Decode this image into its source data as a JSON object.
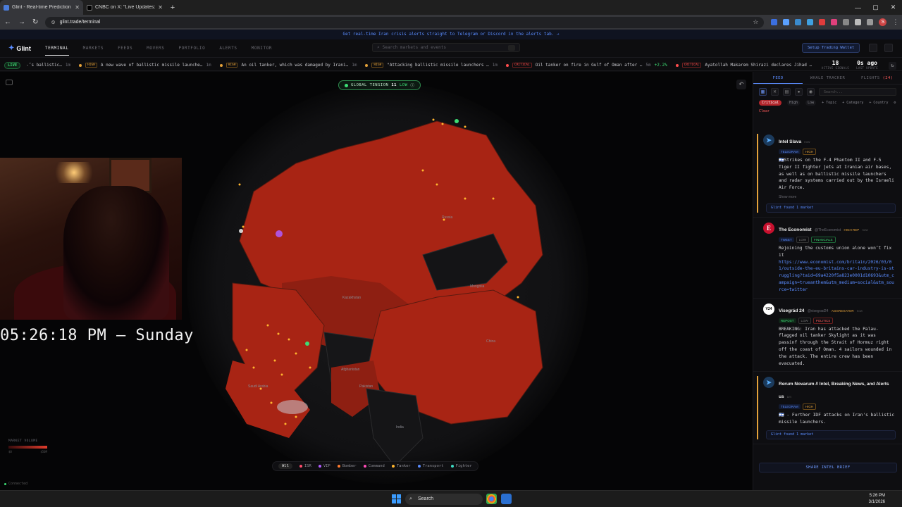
{
  "browser": {
    "tabs": [
      {
        "title": "Glint - Real-time Prediction Ma",
        "active": true
      },
      {
        "title": "CNBC on X: \"Live Updates: Isra",
        "active": false
      }
    ],
    "url": "glint.trade/terminal"
  },
  "banner": "Get real-time Iran crisis alerts straight to Telegram or Discord in the alerts tab. →",
  "nav": {
    "logo": "Glint",
    "items": [
      "TERMINAL",
      "MARKETS",
      "FEEDS",
      "MOVERS",
      "PORTFOLIO",
      "ALERTS",
      "MONITOR"
    ],
    "search_placeholder": "Search markets and events",
    "wallet_button": "Setup Trading Wallet"
  },
  "ticker": {
    "live_label": "LIVE",
    "items": [
      {
        "text": "-’s ballistic…",
        "time": "1m",
        "badge": "",
        "extra": ""
      },
      {
        "text": "A new wave of ballistic missile launche…",
        "time": "1m",
        "badge": "HIGH",
        "extra": ""
      },
      {
        "text": "An oil tanker, which was damaged by Irani…",
        "time": "1m",
        "badge": "HIGH",
        "extra": ""
      },
      {
        "text": "\"Attacking ballistic missile launchers …",
        "time": "1m",
        "badge": "HIGH",
        "extra": ""
      },
      {
        "text": "Oil tanker on fire in Gulf of Oman after …",
        "time": "5m",
        "badge": "CRITICAL",
        "extra": "+2.2%"
      },
      {
        "text": "Ayatollah Makarem Shirazi declares Jihad …",
        "time": "",
        "badge": "CRITICAL",
        "extra": ""
      }
    ],
    "active_signals": "18",
    "active_signals_label": "ACTIVE SIGNALS",
    "last_update": "0s ago",
    "last_update_label": "LAST UPDATE"
  },
  "map": {
    "tension_label": "GLOBAL TENSION",
    "tension_value": "11",
    "tension_level": "LOW",
    "clock": "05:26:18 PM – Sunday",
    "labels": [
      "Russia",
      "Kazakhstan",
      "Mongolia",
      "China",
      "Afghanistan",
      "Pakistan",
      "India",
      "Saudi Arabia",
      "Iran"
    ],
    "market_volume_label": "MARKET VOLUME",
    "volume_min": "$0",
    "volume_max": "$50M",
    "legend": [
      {
        "label": "All",
        "color": ""
      },
      {
        "label": "ISR",
        "color": "#ff4d6d"
      },
      {
        "label": "VIP",
        "color": "#b05cff"
      },
      {
        "label": "Bomber",
        "color": "#ff7a2e"
      },
      {
        "label": "Command",
        "color": "#ff4db8"
      },
      {
        "label": "Tanker",
        "color": "#ffb52e"
      },
      {
        "label": "Transport",
        "color": "#5a8cff"
      },
      {
        "label": "Fighter",
        "color": "#3ddcc4"
      }
    ],
    "status": "Connected"
  },
  "panel": {
    "tabs": [
      {
        "label": "FEED",
        "count": ""
      },
      {
        "label": "WHALE TRACKER",
        "count": ""
      },
      {
        "label": "FLIGHTS",
        "count": "(24)"
      }
    ],
    "search_placeholder": "Search...",
    "filters": {
      "critical": "Critical",
      "high": "High",
      "low": "Low",
      "topic": "+ Topic",
      "category": "+ Category",
      "country": "+ Country",
      "clear": "Clear"
    },
    "cards": [
      {
        "source": "Intel Slava",
        "handle": "",
        "role": "",
        "time": "now",
        "tags": [
          "TELEGRAM",
          "HIGH"
        ],
        "body": "🇮🇱Strikes on the F-4 Phantom II and F-5 Tiger II fighter jets at Iranian air bases, as well as on ballistic missile launchers and radar systems carried out by the Israeli Air Force.",
        "more": "Show more",
        "found": "Glint found 1 market"
      },
      {
        "source": "The Economist",
        "handle": "@TheEconomist",
        "role": "HIGH REP",
        "time": "now",
        "tags": [
          "TWEET",
          "LOW",
          "FINANCIALS"
        ],
        "body": "Rejoining the customs union alone won’t fix it",
        "link": "https://www.economist.com/britain/2026/03/01/outside-the-eu-britains-car-industry-is-struggling?taid=69a4220f5a823e0001d10693&utm_campaign=trueanthem&utm_medium=social&utm_source=twitter"
      },
      {
        "source": "Visegrád 24",
        "handle": "@visegrad24",
        "role": "AGGREGATOR",
        "time": "now",
        "tags": [
          "REPOST",
          "LOW",
          "POLITICS"
        ],
        "body": "BREAKING: Iran has attacked the Palau-flagged oil tanker Skylight as it was passinf through the Strait of Hormuz right off the coast of Oman. 4 sailors wounded in the attack. The entire crew has been evacuated."
      },
      {
        "source": "Rerum Novarum // Intel, Breaking News, and Alerts us",
        "handle": "",
        "role": "",
        "time": "1m",
        "tags": [
          "TELEGRAM",
          "HIGH"
        ],
        "body": "🇮🇱 - Further IDF attacks on Iran's ballistic missile launchers.",
        "found": "Glint found 1 market"
      }
    ],
    "share_button": "SHARE INTEL BRIEF"
  },
  "taskbar": {
    "search": "Search",
    "time": "5:26 PM",
    "date": "3/1/2026"
  }
}
